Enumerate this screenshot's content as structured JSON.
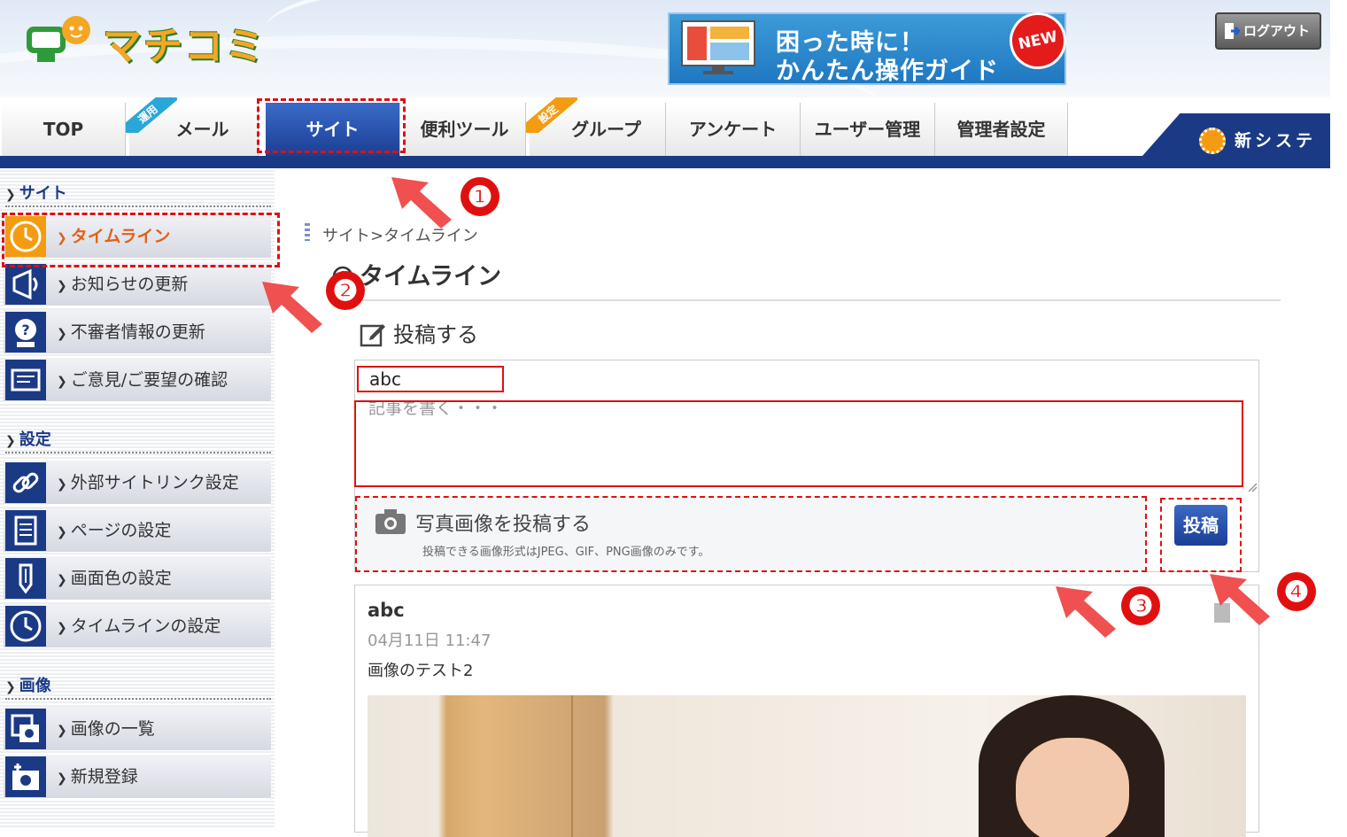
{
  "header": {
    "logo_text": "マチコミ",
    "banner_line1": "困った時に！",
    "banner_line2": "かんたん操作ガイド",
    "banner_badge": "NEW",
    "logout_label": "ログアウト"
  },
  "nav": {
    "tabs": [
      {
        "label": "TOP",
        "ribbon": ""
      },
      {
        "label": "メール",
        "ribbon": "運用"
      },
      {
        "label": "サイト",
        "ribbon": ""
      },
      {
        "label": "便利ツール",
        "ribbon": ""
      },
      {
        "label": "グループ",
        "ribbon": "設定"
      },
      {
        "label": "アンケート",
        "ribbon": ""
      },
      {
        "label": "ユーザー管理",
        "ribbon": ""
      },
      {
        "label": "管理者設定",
        "ribbon": ""
      }
    ],
    "active_tab": "サイト",
    "new_system_label": "新システム"
  },
  "sidebar": {
    "sections": [
      {
        "heading": "サイト",
        "items": [
          "タイムライン",
          "お知らせの更新",
          "不審者情報の更新",
          "ご意見/ご要望の確認"
        ]
      },
      {
        "heading": "設定",
        "items": [
          "外部サイトリンク設定",
          "ページの設定",
          "画面色の設定",
          "タイムラインの設定"
        ]
      },
      {
        "heading": "画像",
        "items": [
          "画像の一覧",
          "新規登録"
        ]
      }
    ],
    "active_item": "タイムライン"
  },
  "main": {
    "breadcrumb": "サイト>タイムライン",
    "page_title": "タイムライン",
    "post_label": "投稿する",
    "title_input_value": "abc",
    "body_placeholder": "記事を書く・・・",
    "photo_label": "写真画像を投稿する",
    "photo_note": "投稿できる画像形式はJPEG、GIF、PNG画像のみです。",
    "submit_label": "投稿"
  },
  "post": {
    "title": "abc",
    "date": "04月11日 11:47",
    "body": "画像のテスト2"
  },
  "annotations": {
    "markers": [
      "❶",
      "❷",
      "❸",
      "❹"
    ],
    "color": "#e01010"
  }
}
